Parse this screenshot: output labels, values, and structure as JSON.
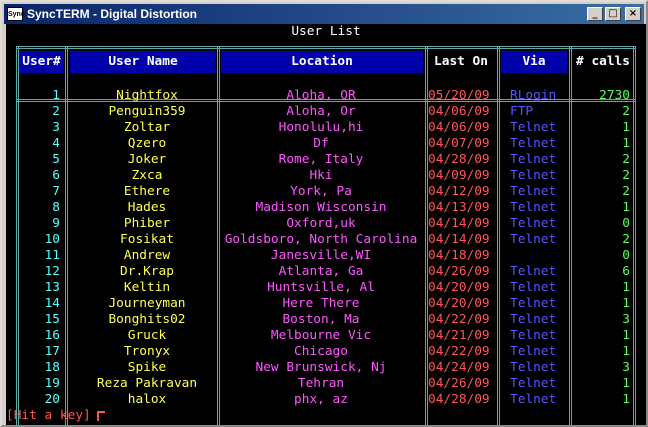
{
  "window": {
    "title": "SyncTERM - Digital Distortion",
    "icon_text": "Sync"
  },
  "screen": {
    "title": "User List",
    "prompt": "[Hit a key]"
  },
  "columns": [
    "User#",
    "User Name",
    "Location",
    "Last On",
    "Via",
    "# calls"
  ],
  "rows": [
    {
      "num": "1",
      "name": "Nightfox",
      "loc": "Aloha, OR",
      "last": "05/20/09",
      "via": "RLogin",
      "calls": "2730"
    },
    {
      "num": "2",
      "name": "Penguin359",
      "loc": "Aloha, Or",
      "last": "04/06/09",
      "via": "FTP",
      "calls": "2"
    },
    {
      "num": "3",
      "name": "Zoltar",
      "loc": "Honolulu,hi",
      "last": "04/06/09",
      "via": "Telnet",
      "calls": "1"
    },
    {
      "num": "4",
      "name": "Qzero",
      "loc": "Df",
      "last": "04/07/09",
      "via": "Telnet",
      "calls": "1"
    },
    {
      "num": "5",
      "name": "Joker",
      "loc": "Rome, Italy",
      "last": "04/28/09",
      "via": "Telnet",
      "calls": "2"
    },
    {
      "num": "6",
      "name": "Zxca",
      "loc": "Hki",
      "last": "04/09/09",
      "via": "Telnet",
      "calls": "2"
    },
    {
      "num": "7",
      "name": "Ethere",
      "loc": "York, Pa",
      "last": "04/12/09",
      "via": "Telnet",
      "calls": "2"
    },
    {
      "num": "8",
      "name": "Hades",
      "loc": "Madison Wisconsin",
      "last": "04/13/09",
      "via": "Telnet",
      "calls": "1"
    },
    {
      "num": "9",
      "name": "Phiber",
      "loc": "Oxford,uk",
      "last": "04/14/09",
      "via": "Telnet",
      "calls": "0"
    },
    {
      "num": "10",
      "name": "Fosikat",
      "loc": "Goldsboro, North Carolina",
      "last": "04/14/09",
      "via": "Telnet",
      "calls": "2"
    },
    {
      "num": "11",
      "name": "Andrew",
      "loc": "Janesville,WI",
      "last": "04/18/09",
      "via": "",
      "calls": "0"
    },
    {
      "num": "12",
      "name": "Dr.Krap",
      "loc": "Atlanta, Ga",
      "last": "04/26/09",
      "via": "Telnet",
      "calls": "6"
    },
    {
      "num": "13",
      "name": "Keltin",
      "loc": "Huntsville, Al",
      "last": "04/20/09",
      "via": "Telnet",
      "calls": "1"
    },
    {
      "num": "14",
      "name": "Journeyman",
      "loc": "Here There",
      "last": "04/20/09",
      "via": "Telnet",
      "calls": "1"
    },
    {
      "num": "15",
      "name": "Bonghits02",
      "loc": "Boston, Ma",
      "last": "04/22/09",
      "via": "Telnet",
      "calls": "3"
    },
    {
      "num": "16",
      "name": "Gruck",
      "loc": "Melbourne Vic",
      "last": "04/21/09",
      "via": "Telnet",
      "calls": "1"
    },
    {
      "num": "17",
      "name": "Tronyx",
      "loc": "Chicago",
      "last": "04/22/09",
      "via": "Telnet",
      "calls": "1"
    },
    {
      "num": "18",
      "name": "Spike",
      "loc": "New Brunswick, Nj",
      "last": "04/24/09",
      "via": "Telnet",
      "calls": "3"
    },
    {
      "num": "19",
      "name": "Reza Pakravan",
      "loc": "Tehran",
      "last": "04/26/09",
      "via": "Telnet",
      "calls": "1"
    },
    {
      "num": "20",
      "name": "halox",
      "loc": "phx, az",
      "last": "04/28/09",
      "via": "Telnet",
      "calls": "1"
    }
  ],
  "colors": {
    "header_bg": "#0000aa",
    "border": "#5fa8a8",
    "user_num": "#55ffff",
    "user_name": "#ffff55",
    "location": "#ff55ff",
    "last_on": "#ff5555",
    "via": "#5555ff",
    "calls": "#55ff55"
  }
}
